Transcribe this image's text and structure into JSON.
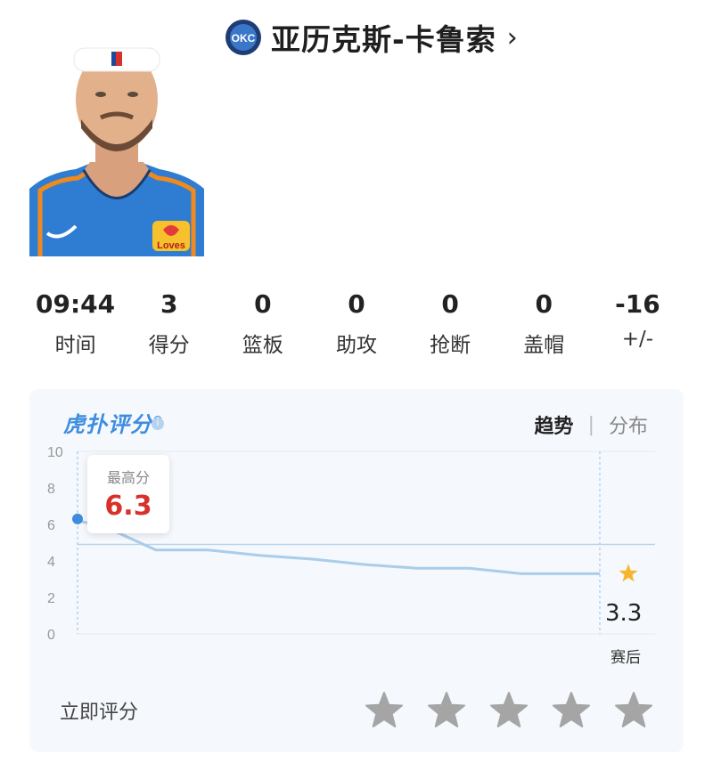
{
  "player": {
    "name": "亚历克斯-卡鲁索",
    "team_logo_text": "OKC",
    "jersey_sponsor": "Loves"
  },
  "stats": [
    {
      "value": "09:44",
      "label": "时间"
    },
    {
      "value": "3",
      "label": "得分"
    },
    {
      "value": "0",
      "label": "篮板"
    },
    {
      "value": "0",
      "label": "助攻"
    },
    {
      "value": "0",
      "label": "抢断"
    },
    {
      "value": "0",
      "label": "盖帽"
    },
    {
      "value": "-16",
      "label": "+/-"
    }
  ],
  "rating": {
    "brand": "虎扑评分",
    "tabs": {
      "active": "趋势",
      "separator": "|",
      "other": "分布"
    },
    "tooltip_label": "最高分",
    "tooltip_value": "6.3",
    "final_value": "3.3",
    "final_label": "赛后",
    "rate_prompt": "立即评分",
    "star_count": 5,
    "colors": {
      "line": "#a9cdea",
      "accent": "#3d8ce0",
      "max_value": "#d8312c",
      "star_active": "#f7b52c",
      "star_empty": "#a5a5a5"
    }
  },
  "chart_data": {
    "type": "line",
    "y_ticks": [
      "10",
      "8",
      "6",
      "4",
      "2",
      "0"
    ],
    "ylim": [
      0,
      10
    ],
    "x": [
      0,
      0.05,
      0.15,
      0.25,
      0.35,
      0.45,
      0.55,
      0.65,
      0.75,
      0.85,
      0.95,
      1.0
    ],
    "values": [
      6.2,
      5.9,
      4.6,
      4.6,
      4.3,
      4.1,
      3.8,
      3.6,
      3.6,
      3.3,
      3.3,
      3.3
    ],
    "reference_line": 4.9,
    "max_point": 6.3,
    "final_point": 3.3
  }
}
